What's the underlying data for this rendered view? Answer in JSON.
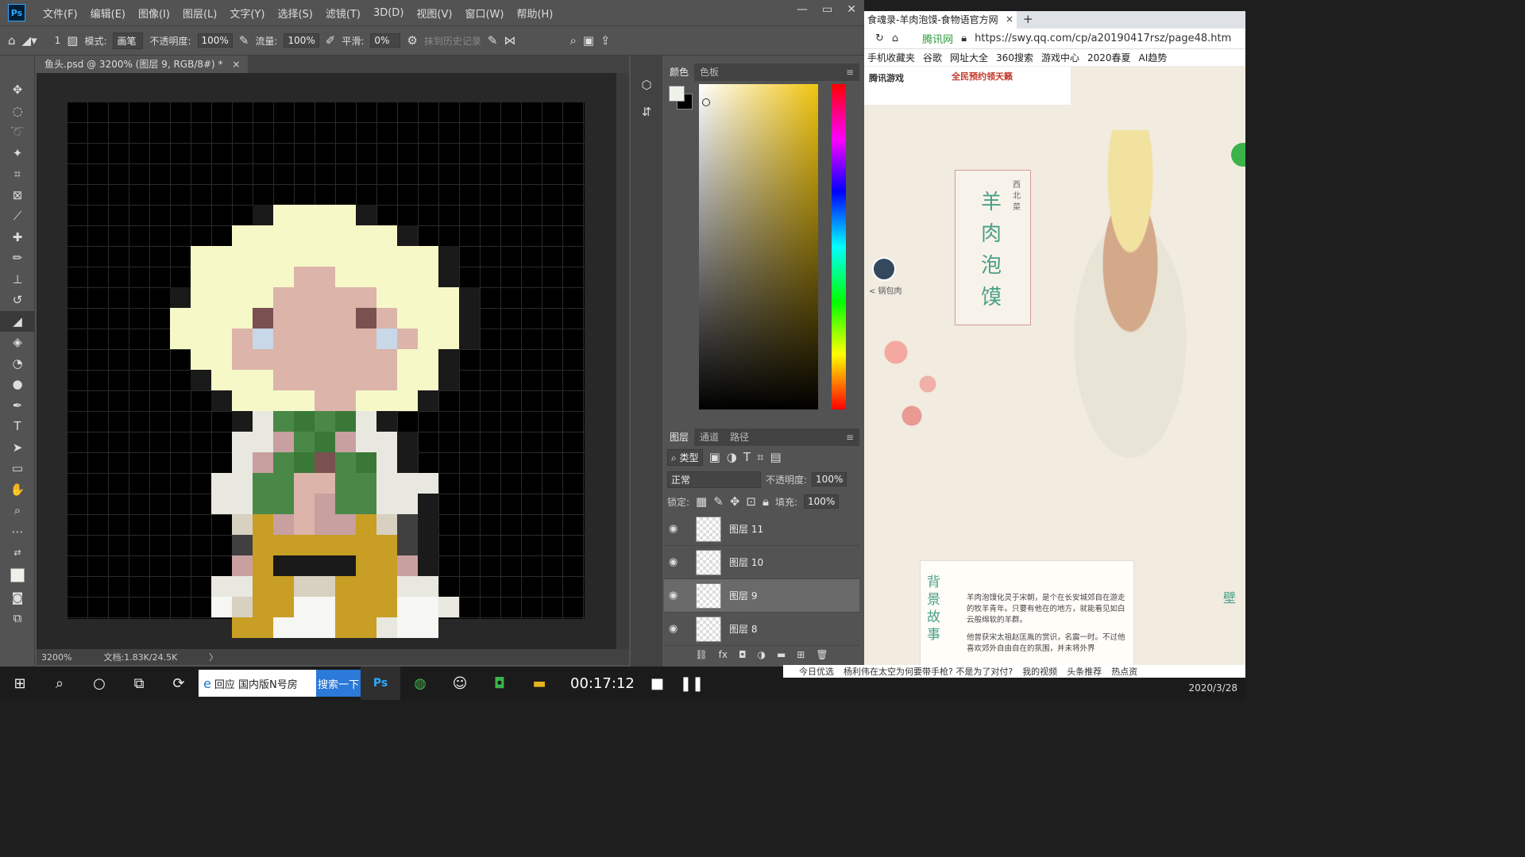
{
  "ps": {
    "logo": "Ps",
    "menus": [
      "文件(F)",
      "编辑(E)",
      "图像(I)",
      "图层(L)",
      "文字(Y)",
      "选择(S)",
      "滤镜(T)",
      "3D(D)",
      "视图(V)",
      "窗口(W)",
      "帮助(H)"
    ],
    "options": {
      "brush_size": "1",
      "mode_label": "模式:",
      "mode_value": "画笔",
      "opacity_label": "不透明度:",
      "opacity_value": "100%",
      "flow_label": "流量:",
      "flow_value": "100%",
      "smooth_label": "平滑:",
      "smooth_value": "0%",
      "history_label": "抹到历史记录"
    },
    "doc_tab": "鱼头.psd @ 3200% (图层 9, RGB/8#) *",
    "status": {
      "zoom": "3200%",
      "doc": "文档:1.83K/24.5K"
    },
    "color_panel": {
      "tabs": [
        "颜色",
        "色板"
      ],
      "fg": "#eef0ea",
      "bg": "#000000"
    },
    "layers_panel": {
      "tabs": [
        "图层",
        "通道",
        "路径"
      ],
      "filter": "类型",
      "blend": "正常",
      "opacity_label": "不透明度:",
      "opacity_value": "100%",
      "lock_label": "锁定:",
      "fill_label": "填充:",
      "fill_value": "100%",
      "layers": [
        {
          "name": "图层 11",
          "selected": false
        },
        {
          "name": "图层 10",
          "selected": false
        },
        {
          "name": "图层 9",
          "selected": true
        },
        {
          "name": "图层 8",
          "selected": false
        }
      ]
    }
  },
  "browser": {
    "tab_title": "食魂录-羊肉泡馍-食物语官方网",
    "url": "https://swy.qq.com/cp/a20190417rsz/page48.htm",
    "site_badge": "腾讯网",
    "bookmarks": [
      "手机收藏夹",
      "谷歌",
      "网址大全",
      "360搜索",
      "游戏中心",
      "2020春夏",
      "AI趋势"
    ],
    "page": {
      "ad_logo": "腾讯游戏",
      "ad_text": "全民预约领天籁",
      "title": "羊肉泡馍",
      "side_labels": [
        "西",
        "北",
        "菜"
      ],
      "caption": "< 锅包肉",
      "section": "背景故事",
      "story1": "羊肉泡馍化灵于宋朝，是个在长安城郊自在游走的牧羊青年。只要有他在的地方，就能看见如白云般绵软的羊群。",
      "story2": "他曾获宋太祖赵匡胤的赏识，名震一时。不过他喜欢郊外自由自在的氛围，并未将外界",
      "right_tag": "壁"
    }
  },
  "taskbar": {
    "search_text": "回应 国内版N号房",
    "search_btn": "搜索一下",
    "timer": "00:17:12",
    "date": "2020/3/28",
    "news": [
      "今日优选",
      "杨利伟在太空为何要带手枪? 不是为了对付?",
      "我的视频",
      "头条推荐",
      "热点资"
    ]
  }
}
